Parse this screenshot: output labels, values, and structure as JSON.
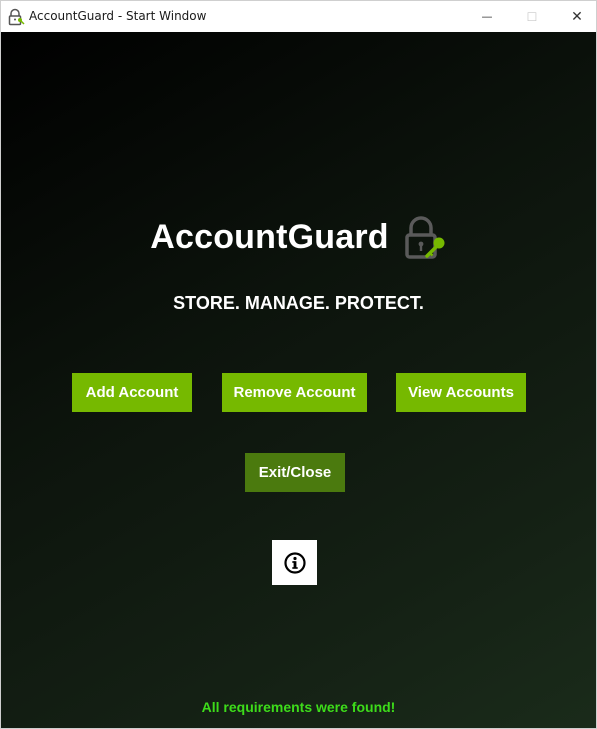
{
  "window": {
    "title": "AccountGuard - Start Window",
    "controls": {
      "minimize": "—",
      "maximize": "☐",
      "close": "✕"
    }
  },
  "header": {
    "app_name": "AccountGuard",
    "tagline": "STORE. MANAGE. PROTECT.",
    "logo_icon": "lock-key-icon"
  },
  "buttons": {
    "add_account": "Add Account",
    "remove_account": "Remove Account",
    "view_accounts": "View Accounts",
    "exit_close": "Exit/Close",
    "info_icon": "info-icon"
  },
  "status": {
    "message": "All requirements were found!"
  },
  "colors": {
    "accent": "#76b900",
    "exit_button": "#4b7a0e",
    "status_text": "#3ddc1a",
    "background_start": "#000000",
    "background_end": "#1a2b1a"
  }
}
